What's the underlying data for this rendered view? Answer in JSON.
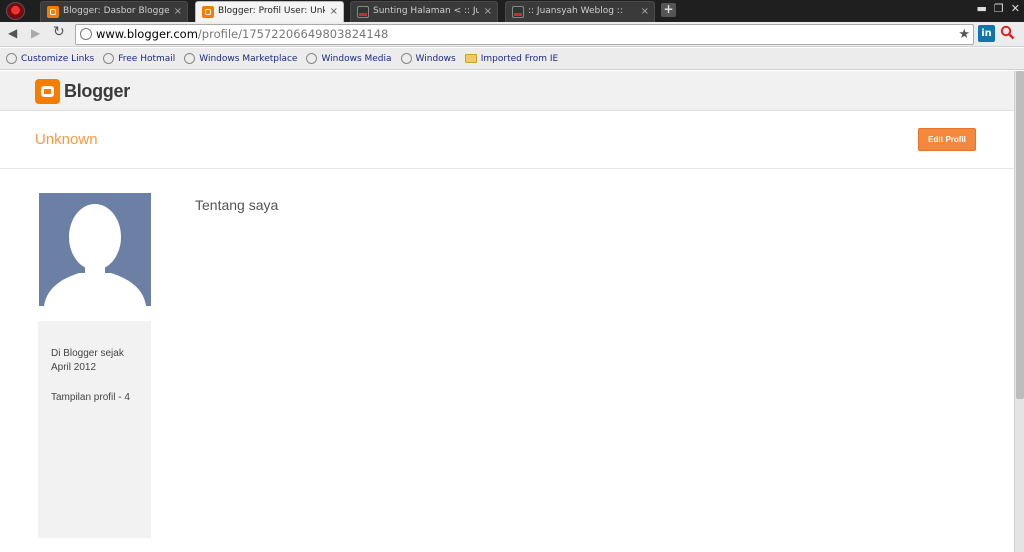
{
  "tabs": [
    {
      "title": "Blogger: Dasbor Blogger",
      "icon": "blogger-icon",
      "active": false
    },
    {
      "title": "Blogger: Profil User: Unknow",
      "icon": "blogger-icon",
      "active": true
    },
    {
      "title": "Sunting Halaman < :: Juansy",
      "icon": "page-icon",
      "active": false
    },
    {
      "title": ":: Juansyah Weblog ::",
      "icon": "page-icon",
      "active": false
    }
  ],
  "tab_close_glyph": "×",
  "newtab_glyph": "+",
  "window_controls": {
    "minimize": "▬",
    "restore": "❐",
    "close": "✕"
  },
  "nav": {
    "back": "◀",
    "forward": "▶",
    "reload": "↻"
  },
  "address": {
    "host": "www.blogger.com",
    "path": "/profile/17572206649803824148"
  },
  "star": "★",
  "linkedin_label": "in",
  "bookmarks": [
    {
      "label": "Customize Links",
      "icon": "globe-icon"
    },
    {
      "label": "Free Hotmail",
      "icon": "globe-icon"
    },
    {
      "label": "Windows Marketplace",
      "icon": "globe-icon"
    },
    {
      "label": "Windows Media",
      "icon": "globe-icon"
    },
    {
      "label": "Windows",
      "icon": "globe-icon"
    },
    {
      "label": "Imported From IE",
      "icon": "folder-icon"
    }
  ],
  "site": {
    "brand": "Blogger"
  },
  "profile": {
    "name": "Unknown",
    "edit_label": "Edit Profil",
    "since_line1": "Di Blogger sejak",
    "since_line2": "April 2012",
    "views": "Tampilan profil - 4",
    "about_heading": "Tentang saya"
  },
  "colors": {
    "accent": "#f5883c",
    "name": "#f79a41",
    "brand": "#f57d00",
    "avatar_bg": "#6c7fa4"
  }
}
